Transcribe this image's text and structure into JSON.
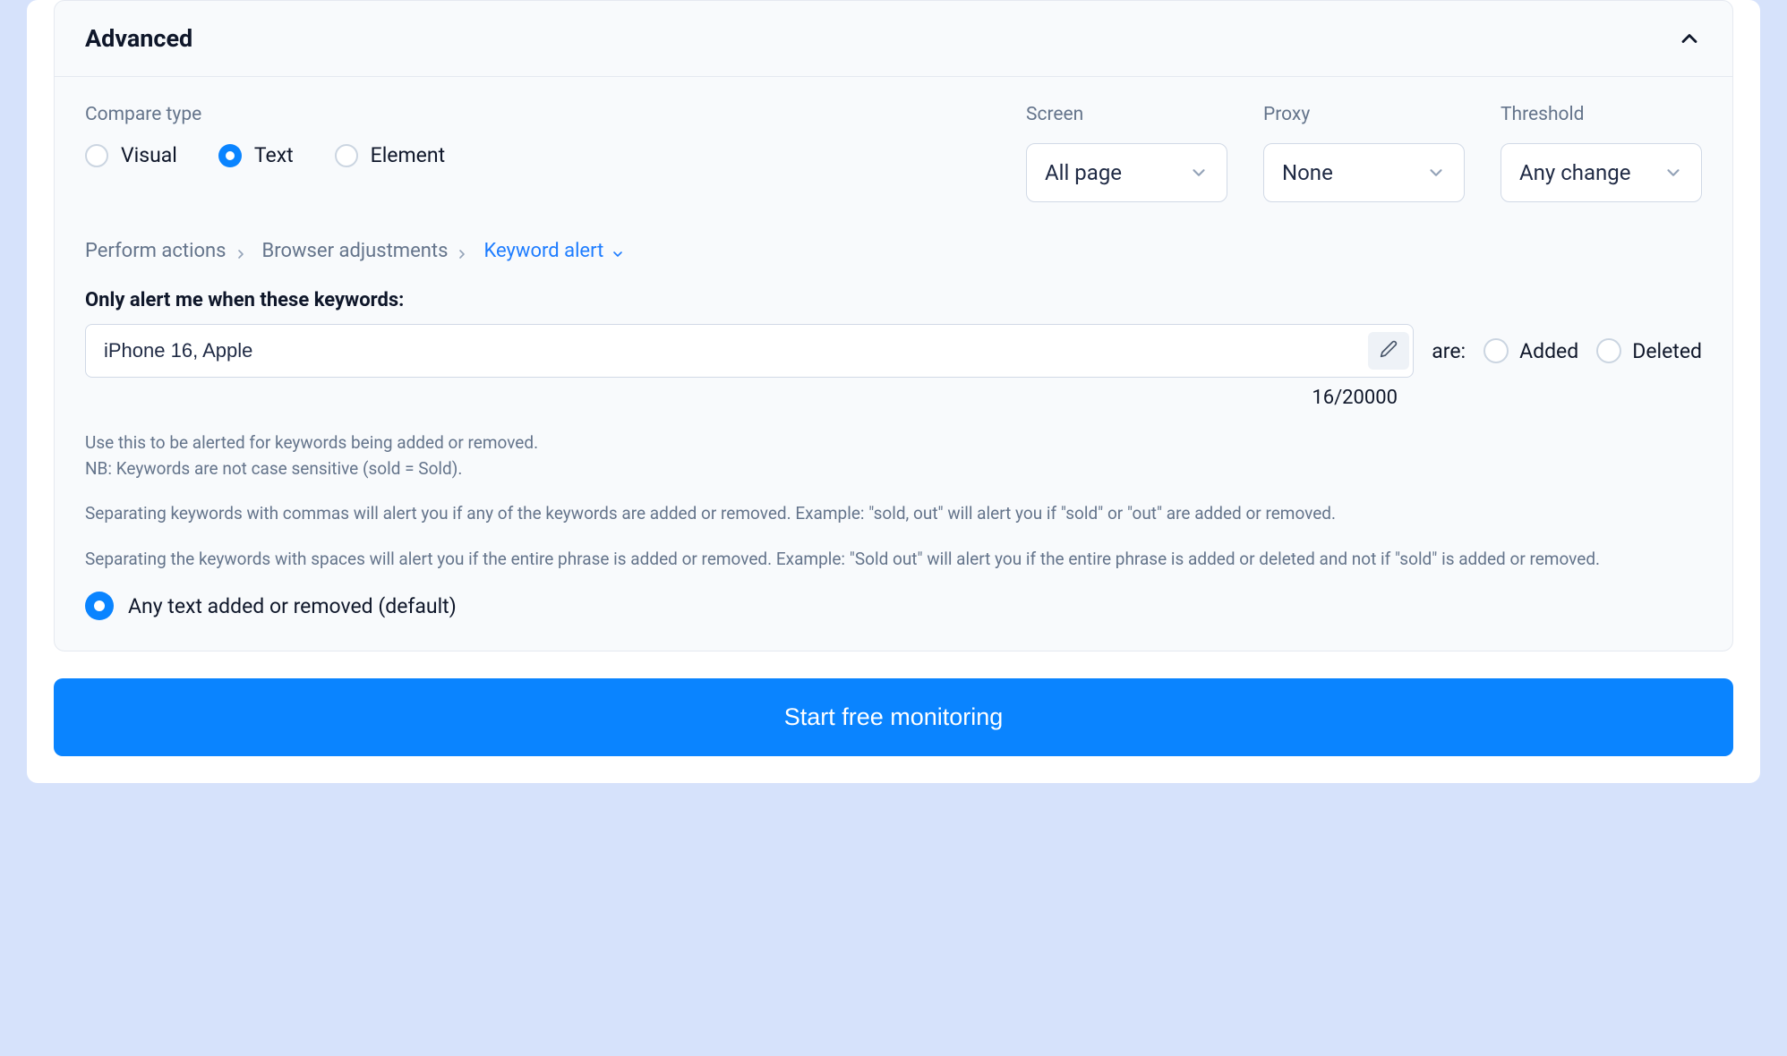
{
  "panel": {
    "title": "Advanced"
  },
  "compare": {
    "label": "Compare type",
    "options": {
      "visual": "Visual",
      "text": "Text",
      "element": "Element"
    }
  },
  "screen": {
    "label": "Screen",
    "value": "All page"
  },
  "proxy": {
    "label": "Proxy",
    "value": "None"
  },
  "threshold": {
    "label": "Threshold",
    "value": "Any change"
  },
  "breadcrumb": {
    "perform": "Perform actions",
    "browser": "Browser adjustments",
    "keyword": "Keyword alert"
  },
  "keywords": {
    "section_title": "Only alert me when these keywords:",
    "value": "iPhone 16, Apple",
    "are_label": "are:",
    "added": "Added",
    "deleted": "Deleted",
    "counter": "16/20000"
  },
  "helper": {
    "line1": "Use this to be alerted for keywords being added or removed.",
    "line2": "NB: Keywords are not case sensitive (sold = Sold).",
    "line3": "Separating keywords with commas will alert you if any of the keywords are added or removed. Example: \"sold, out\" will alert you if \"sold\" or \"out\" are added or removed.",
    "line4": "Separating the keywords with spaces will alert you if the entire phrase is added or removed. Example: \"Sold out\" will alert you if the entire phrase is added or deleted and not if \"sold\" is added or removed."
  },
  "default_option": "Any text added or removed (default)",
  "cta_label": "Start free monitoring"
}
